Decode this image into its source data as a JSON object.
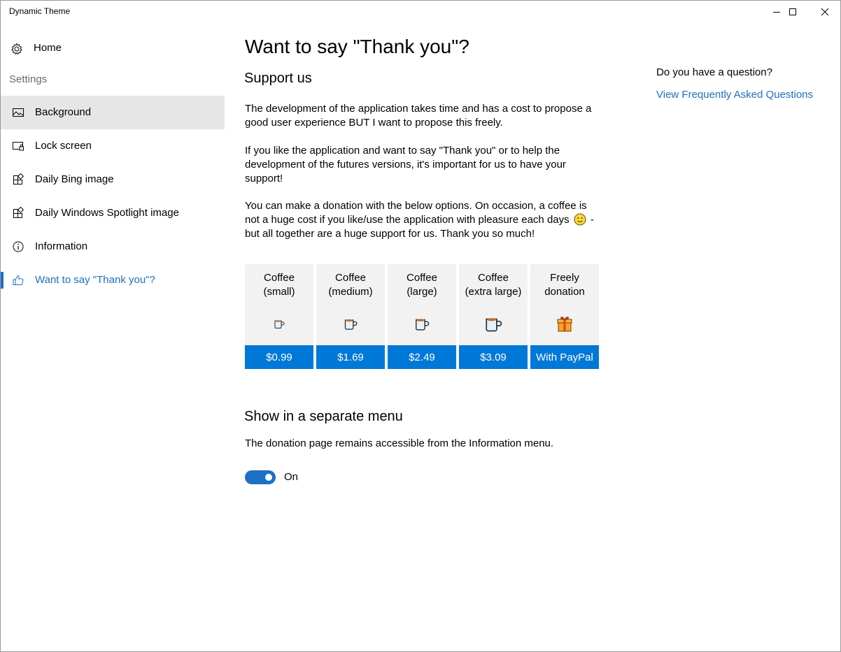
{
  "window": {
    "title": "Dynamic Theme"
  },
  "sidebar": {
    "home_label": "Home",
    "settings_header": "Settings",
    "items": [
      {
        "label": "Background",
        "icon": "image-icon"
      },
      {
        "label": "Lock screen",
        "icon": "lock-screen-icon"
      },
      {
        "label": "Daily Bing image",
        "icon": "apps-add-icon"
      },
      {
        "label": "Daily Windows Spotlight image",
        "icon": "apps-add-icon"
      },
      {
        "label": "Information",
        "icon": "info-icon"
      },
      {
        "label": "Want to say \"Thank you\"?",
        "icon": "thumbs-up-icon"
      }
    ],
    "selected_index": 0,
    "active_index": 5
  },
  "main": {
    "title": "Want to say \"Thank you\"?",
    "support_title": "Support us",
    "para1": "The development of the application takes time and has a cost to propose a good user experience BUT I want to propose this freely.",
    "para2": "If you like the application and want to say \"Thank you\" or to help the development of the futures versions, it's important for us to have your support!",
    "para3_before": "You can make a donation with the below options. On occasion, a coffee is not a huge cost if you like/use the application with pleasure each days",
    "para3_after": " - but all together are a huge support for us. Thank you so much!",
    "donations": [
      {
        "name_line1": "Coffee",
        "name_line2": "(small)",
        "price": "$0.99",
        "icon": "coffee-small-icon"
      },
      {
        "name_line1": "Coffee",
        "name_line2": "(medium)",
        "price": "$1.69",
        "icon": "coffee-medium-icon"
      },
      {
        "name_line1": "Coffee",
        "name_line2": "(large)",
        "price": "$2.49",
        "icon": "coffee-large-icon"
      },
      {
        "name_line1": "Coffee",
        "name_line2": "(extra large)",
        "price": "$3.09",
        "icon": "coffee-xl-icon"
      },
      {
        "name_line1": "Freely",
        "name_line2": "donation",
        "price": "With PayPal",
        "icon": "gift-icon"
      }
    ],
    "separate_menu_title": "Show in a separate menu",
    "separate_menu_desc": "The donation page remains accessible from the Information menu.",
    "toggle_state": "On"
  },
  "aside": {
    "question": "Do you have a question?",
    "faq_link": "View Frequently Asked Questions"
  },
  "colors": {
    "accent": "#0078d7",
    "link": "#1d6fc5",
    "selected_bg": "#e6e6e6",
    "card_bg": "#f2f2f2"
  }
}
